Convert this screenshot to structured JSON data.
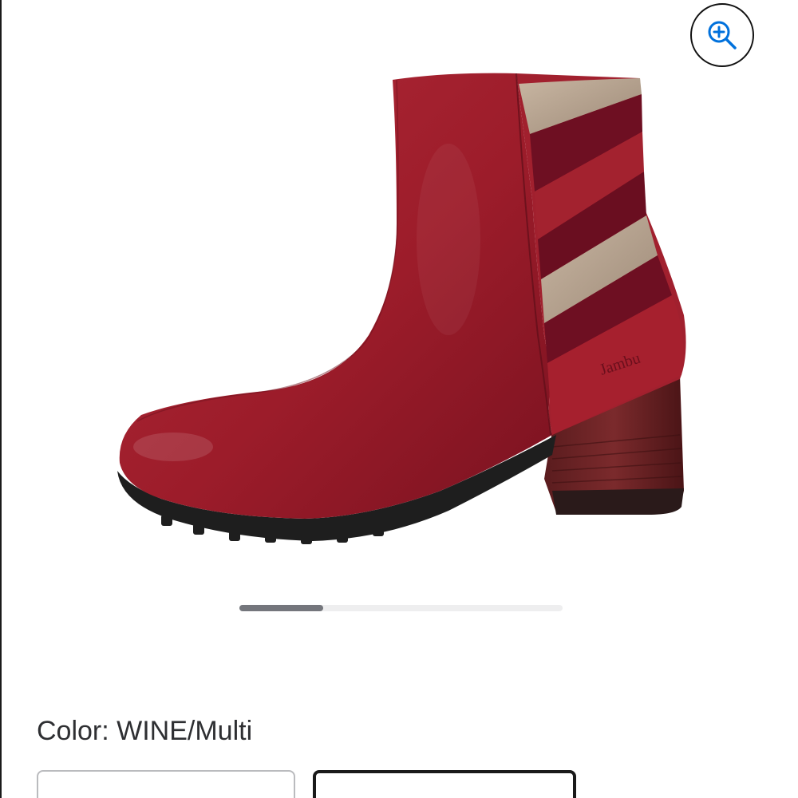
{
  "zoom": {
    "icon": "zoom-in-icon",
    "accent": "#0071dc"
  },
  "product": {
    "image_alt": "Jambu wine leather ankle boot",
    "brand_mark": "Jambu"
  },
  "carousel": {
    "progress": 0.26
  },
  "color": {
    "label": "Color: WINE/Multi"
  },
  "swatches": [
    {
      "name": "swatch-option-1",
      "selected": false
    },
    {
      "name": "swatch-option-2",
      "selected": true
    }
  ]
}
